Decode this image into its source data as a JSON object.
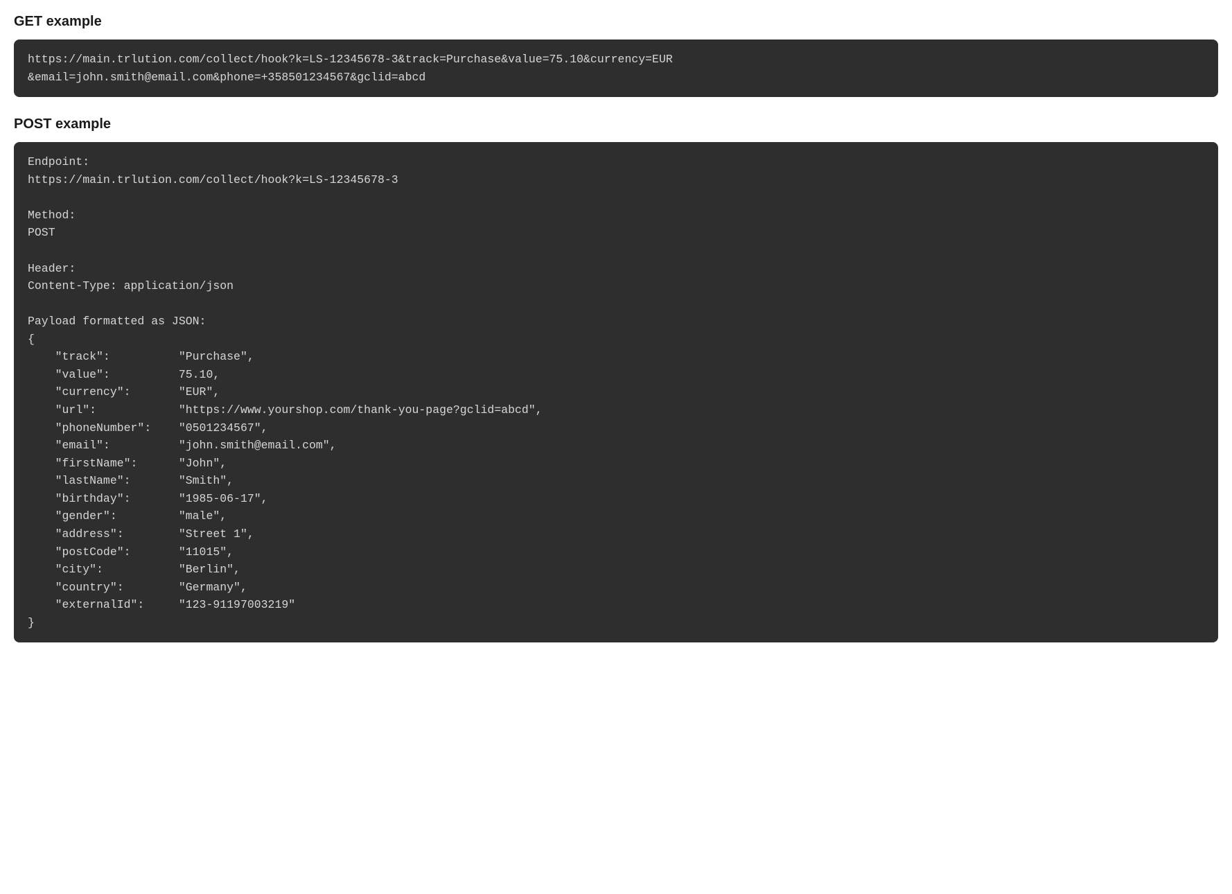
{
  "sections": {
    "get": {
      "heading": "GET example",
      "code": "https://main.trlution.com/collect/hook?k=LS-12345678-3&track=Purchase&value=75.10&currency=EUR\n&email=john.smith@email.com&phone=+358501234567&gclid=abcd"
    },
    "post": {
      "heading": "POST example",
      "code": "Endpoint:\nhttps://main.trlution.com/collect/hook?k=LS-12345678-3\n\nMethod:\nPOST\n\nHeader:\nContent-Type: application/json\n\nPayload formatted as JSON:\n{\n    \"track\":          \"Purchase\",\n    \"value\":          75.10,\n    \"currency\":       \"EUR\",\n    \"url\":            \"https://www.yourshop.com/thank-you-page?gclid=abcd\",\n    \"phoneNumber\":    \"0501234567\",\n    \"email\":          \"john.smith@email.com\",\n    \"firstName\":      \"John\",\n    \"lastName\":       \"Smith\",\n    \"birthday\":       \"1985-06-17\",\n    \"gender\":         \"male\",\n    \"address\":        \"Street 1\",\n    \"postCode\":       \"11015\",\n    \"city\":           \"Berlin\",\n    \"country\":        \"Germany\",\n    \"externalId\":     \"123-91197003219\"\n}"
    }
  }
}
